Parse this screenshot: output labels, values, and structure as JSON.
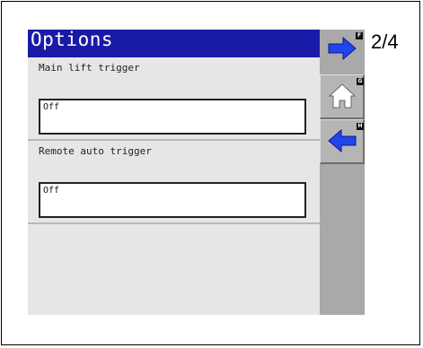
{
  "screen": {
    "title": "Options",
    "page_indicator": "2/4"
  },
  "sections": [
    {
      "label": "Main lift trigger",
      "value": "Off"
    },
    {
      "label": "Remote auto trigger",
      "value": "Off"
    }
  ],
  "sidebar": {
    "buttons": [
      {
        "icon": "arrow-right-icon",
        "key": "F"
      },
      {
        "icon": "home-icon",
        "key": "G"
      },
      {
        "icon": "arrow-left-icon",
        "key": "H"
      }
    ]
  },
  "colors": {
    "title_bar": "#1a1aa8",
    "arrow_blue": "#2244ee",
    "panel": "#e6e6e6",
    "sidebar": "#a9a9a9"
  }
}
